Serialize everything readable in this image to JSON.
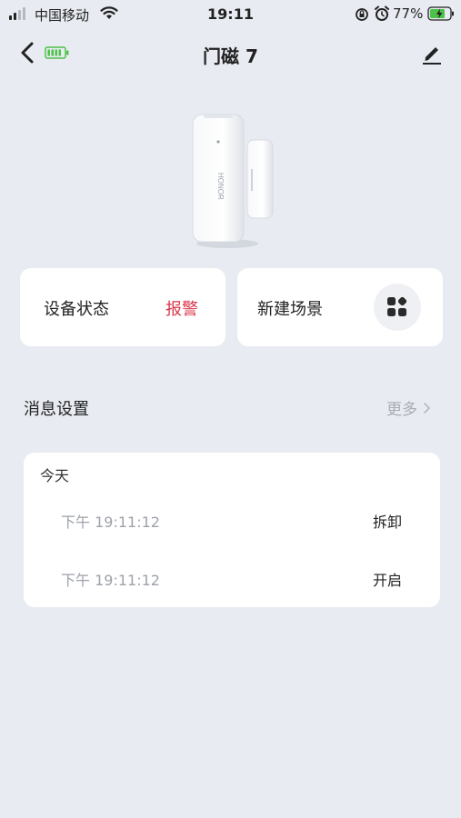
{
  "status_bar": {
    "carrier": "中国移动",
    "time": "19:11",
    "battery_percent": "77%",
    "icons": [
      "signal-icon",
      "wifi-icon",
      "orientation-lock-icon",
      "alarm-icon",
      "battery-charging-icon"
    ]
  },
  "nav": {
    "title": "门磁 7",
    "icons": [
      "back-icon",
      "device-battery-icon",
      "edit-icon"
    ]
  },
  "device": {
    "image_icon": "door-sensor-image",
    "brand_text": "HONOR"
  },
  "cards": {
    "status": {
      "label": "设备状态",
      "value": "报警"
    },
    "scene": {
      "label": "新建场景",
      "icon": "scene-grid-icon"
    }
  },
  "message_settings": {
    "label": "消息设置",
    "more": "更多"
  },
  "log": {
    "day": "今天",
    "entries": [
      {
        "time": "下午 19:11:12",
        "event": "拆卸"
      },
      {
        "time": "下午 19:11:12",
        "event": "开启"
      }
    ]
  },
  "colors": {
    "background": "#e8ebf1",
    "alarm": "#d9364a",
    "battery_green": "#4cc24a"
  }
}
